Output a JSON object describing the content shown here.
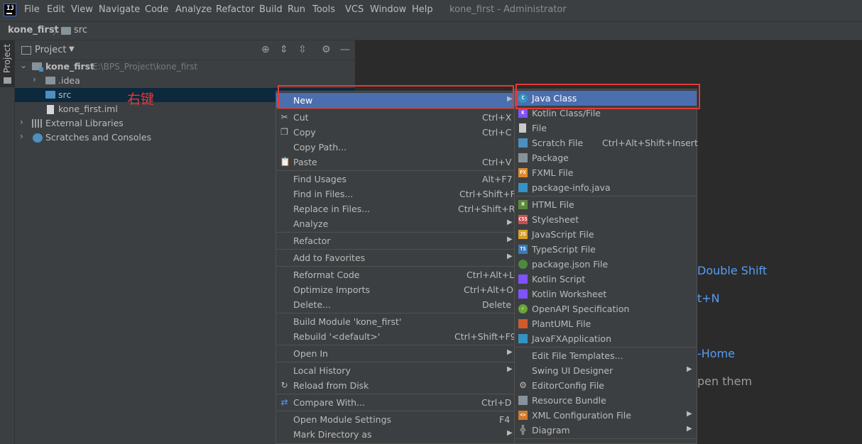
{
  "menubar": {
    "logo": "IJ",
    "items": [
      "File",
      "Edit",
      "View",
      "Navigate",
      "Code",
      "Analyze",
      "Refactor",
      "Build",
      "Run",
      "Tools",
      "VCS",
      "Window",
      "Help"
    ],
    "window_title": "kone_first - Administrator"
  },
  "breadcrumb": {
    "project": "kone_first",
    "folder": "src"
  },
  "tool_strip": {
    "label": "Project"
  },
  "project_panel": {
    "title": "Project",
    "tree": {
      "root": {
        "label": "kone_first",
        "path": "E:\\BPS_Project\\kone_first"
      },
      "idea": ".idea",
      "src": "src",
      "iml": "kone_first.iml",
      "ext_libs": "External Libraries",
      "scratches": "Scratches and Consoles"
    }
  },
  "annotation": "右键",
  "editor_hints": [
    "Double Shift",
    "t+N",
    "-Home",
    "pen them"
  ],
  "context_menu": {
    "new": "New",
    "cut": "Cut",
    "cut_sc": "Ctrl+X",
    "copy": "Copy",
    "copy_sc": "Ctrl+C",
    "copy_path": "Copy Path...",
    "paste": "Paste",
    "paste_sc": "Ctrl+V",
    "find_usages": "Find Usages",
    "find_usages_sc": "Alt+F7",
    "find_in_files": "Find in Files...",
    "find_in_files_sc": "Ctrl+Shift+F",
    "replace_in_files": "Replace in Files...",
    "replace_in_files_sc": "Ctrl+Shift+R",
    "analyze": "Analyze",
    "refactor": "Refactor",
    "add_favorites": "Add to Favorites",
    "reformat": "Reformat Code",
    "reformat_sc": "Ctrl+Alt+L",
    "optimize_imports": "Optimize Imports",
    "optimize_imports_sc": "Ctrl+Alt+O",
    "delete": "Delete...",
    "delete_sc": "Delete",
    "build_module": "Build Module 'kone_first'",
    "rebuild": "Rebuild '<default>'",
    "rebuild_sc": "Ctrl+Shift+F9",
    "open_in": "Open In",
    "local_history": "Local History",
    "reload": "Reload from Disk",
    "compare_with": "Compare With...",
    "compare_with_sc": "Ctrl+D",
    "module_settings": "Open Module Settings",
    "module_settings_sc": "F4",
    "mark_directory": "Mark Directory as"
  },
  "new_submenu": {
    "java_class": "Java Class",
    "kotlin_class": "Kotlin Class/File",
    "file": "File",
    "scratch_file": "Scratch File",
    "scratch_file_sc": "Ctrl+Alt+Shift+Insert",
    "package": "Package",
    "fxml_file": "FXML File",
    "package_info": "package-info.java",
    "html_file": "HTML File",
    "stylesheet": "Stylesheet",
    "javascript_file": "JavaScript File",
    "typescript_file": "TypeScript File",
    "package_json": "package.json File",
    "kotlin_script": "Kotlin Script",
    "kotlin_worksheet": "Kotlin Worksheet",
    "openapi": "OpenAPI Specification",
    "plantuml": "PlantUML File",
    "javafx_app": "JavaFXApplication",
    "edit_templates": "Edit File Templates...",
    "swing_designer": "Swing UI Designer",
    "editorconfig": "EditorConfig File",
    "resource_bundle": "Resource Bundle",
    "xml_config": "XML Configuration File",
    "diagram": "Diagram"
  },
  "colors": {
    "accent_selection": "#4b6eaf",
    "annotation_red": "#e53935",
    "hint_blue": "#589df6",
    "panel_bg": "#3c3f41",
    "editor_bg": "#2b2b2b"
  }
}
